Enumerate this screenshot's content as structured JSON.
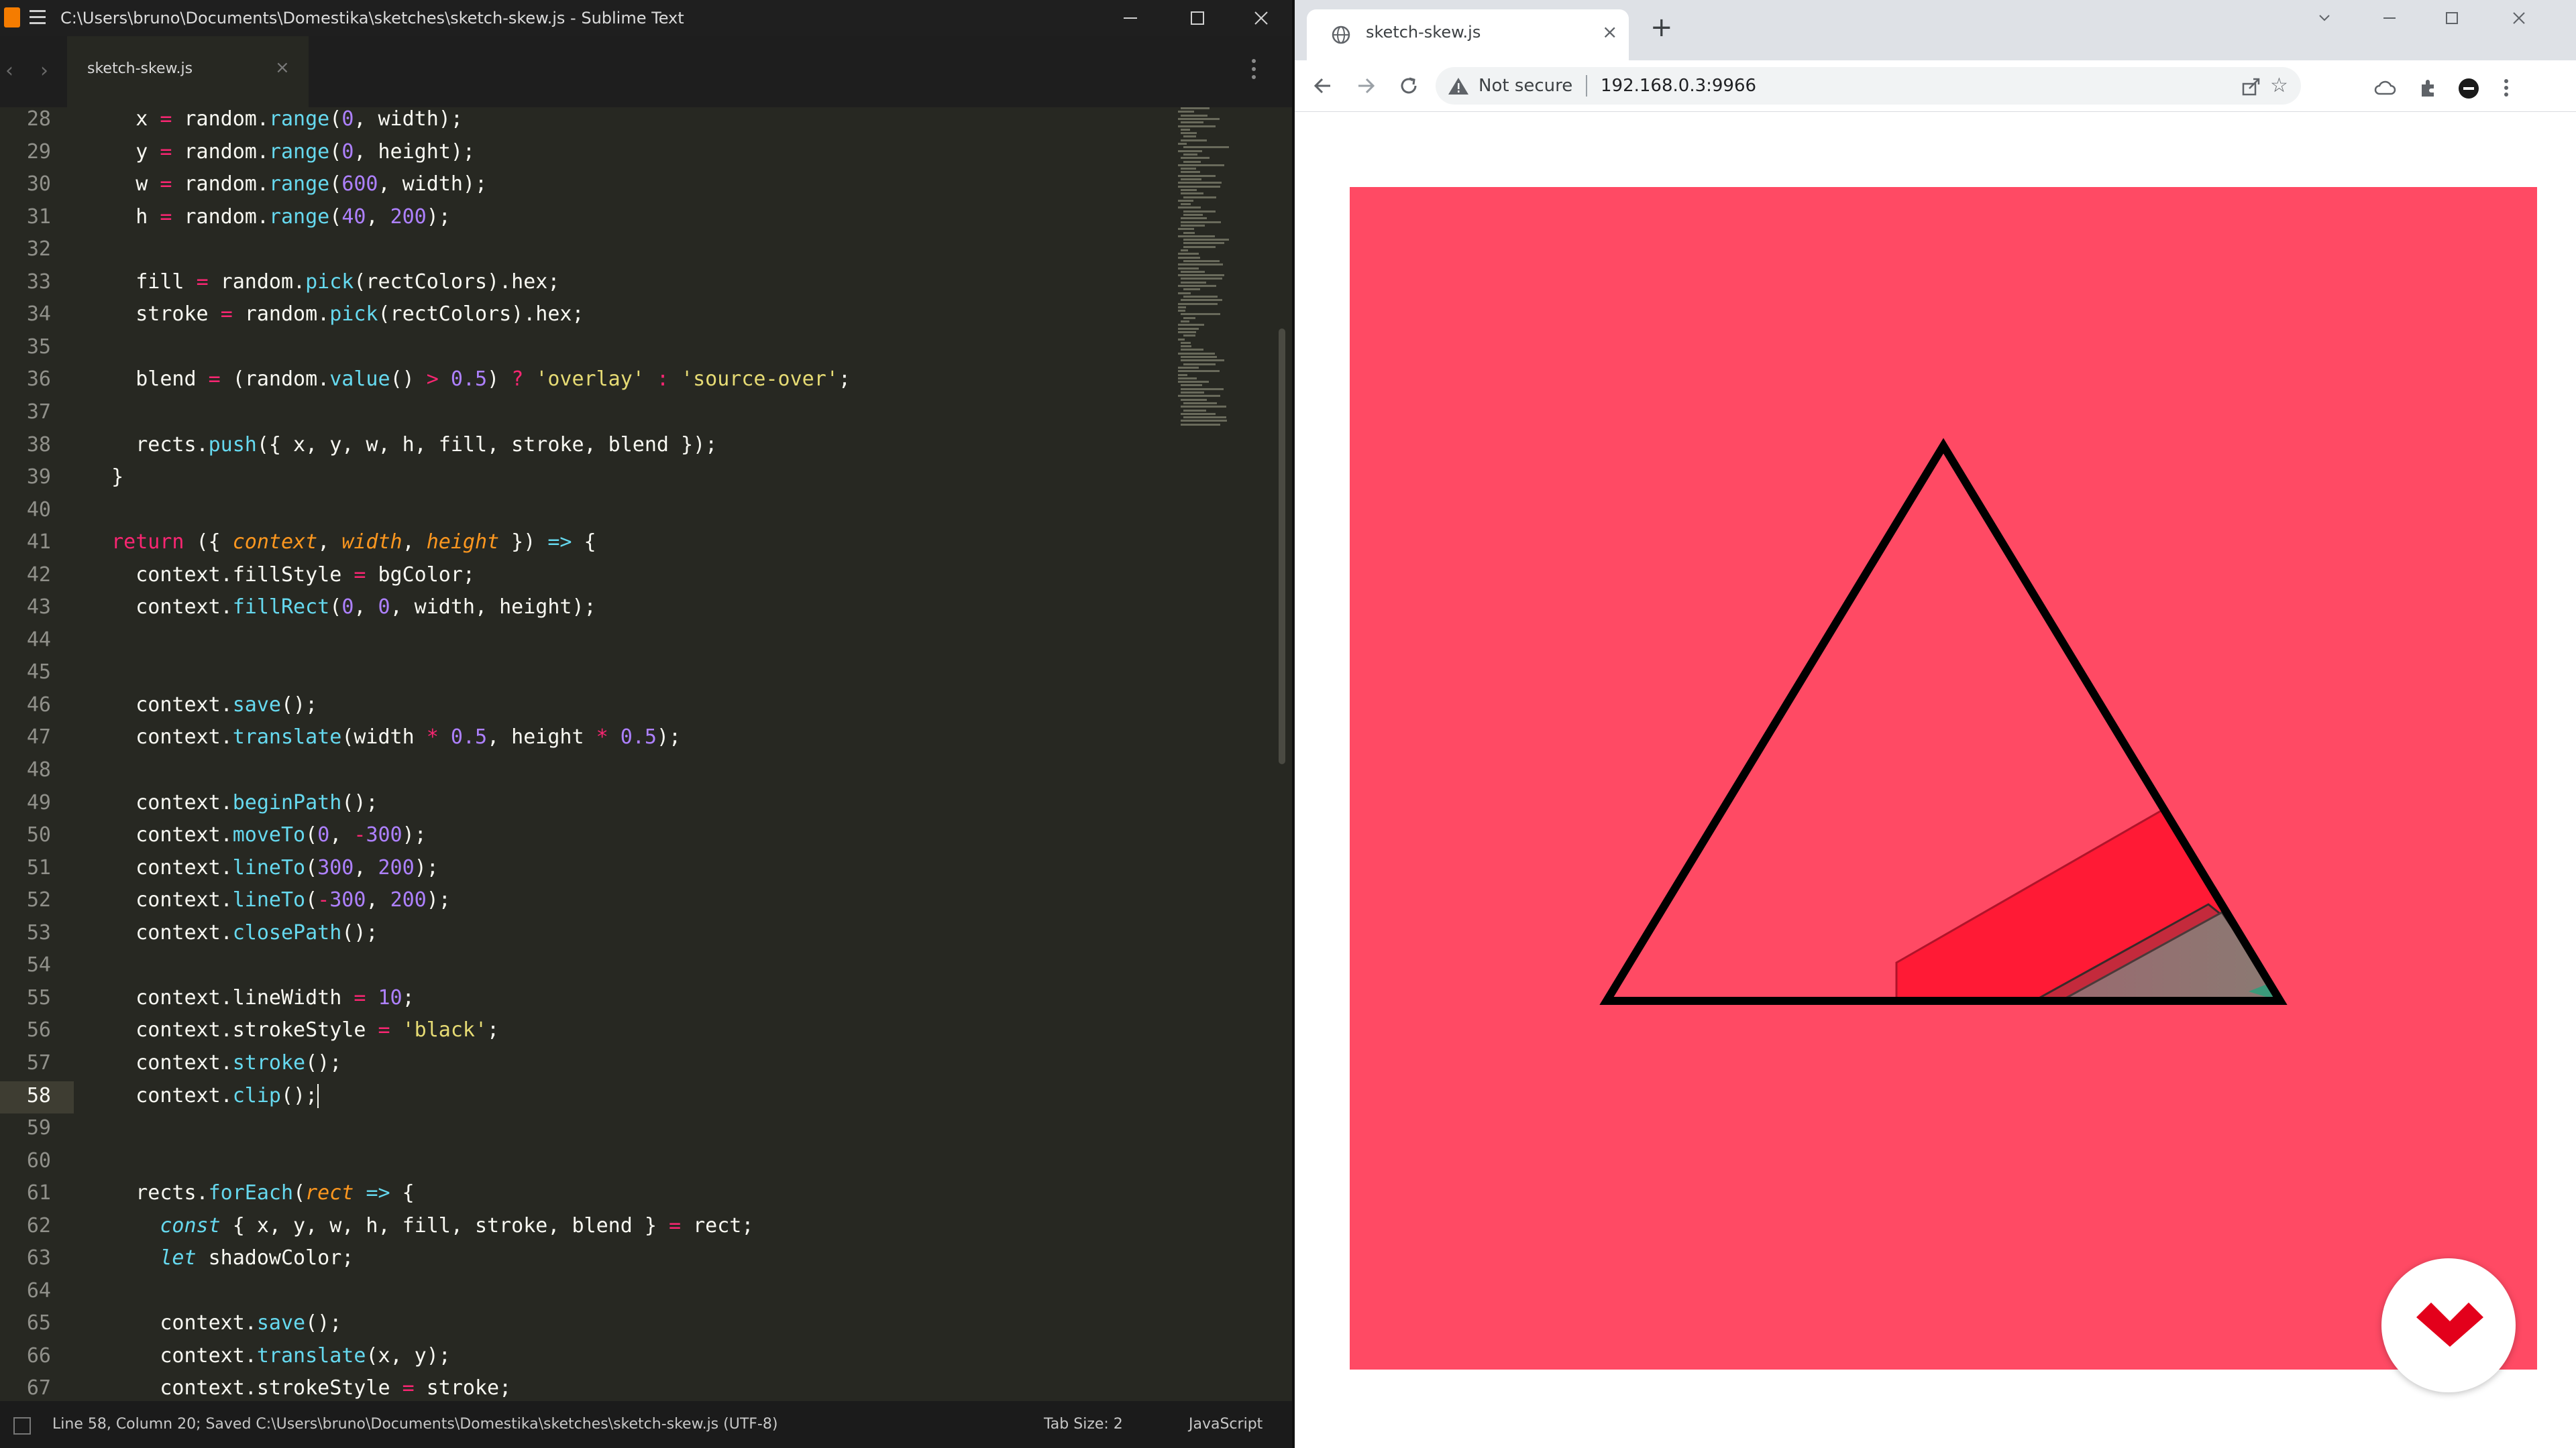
{
  "editor": {
    "window_title": "C:\\Users\\bruno\\Documents\\Domestika\\sketches\\sketch-skew.js - Sublime Text",
    "tab_label": "sketch-skew.js",
    "status": {
      "position": "Line 58, Column 20; Saved C:\\Users\\bruno\\Documents\\Domestika\\sketches\\sketch-skew.js (UTF-8)",
      "tab_size": "Tab Size: 2",
      "syntax": "JavaScript"
    },
    "current_line": 58,
    "lines": [
      {
        "n": 28,
        "html": "    x <span class=\"o\">=</span> random.<span class=\"f\">range</span>(<span class=\"n\">0</span>, width);"
      },
      {
        "n": 29,
        "html": "    y <span class=\"o\">=</span> random.<span class=\"f\">range</span>(<span class=\"n\">0</span>, height);"
      },
      {
        "n": 30,
        "html": "    w <span class=\"o\">=</span> random.<span class=\"f\">range</span>(<span class=\"n\">600</span>, width);"
      },
      {
        "n": 31,
        "html": "    h <span class=\"o\">=</span> random.<span class=\"f\">range</span>(<span class=\"n\">40</span>, <span class=\"n\">200</span>);"
      },
      {
        "n": 32,
        "html": ""
      },
      {
        "n": 33,
        "html": "    fill <span class=\"o\">=</span> random.<span class=\"f\">pick</span>(rectColors).hex;"
      },
      {
        "n": 34,
        "html": "    stroke <span class=\"o\">=</span> random.<span class=\"f\">pick</span>(rectColors).hex;"
      },
      {
        "n": 35,
        "html": ""
      },
      {
        "n": 36,
        "html": "    blend <span class=\"o\">=</span> (random.<span class=\"f\">value</span>() <span class=\"o\">&gt;</span> <span class=\"n\">0.5</span>) <span class=\"o\">?</span> <span class=\"s\">'overlay'</span> <span class=\"o\">:</span> <span class=\"s\">'source-over'</span>;"
      },
      {
        "n": 37,
        "html": ""
      },
      {
        "n": 38,
        "html": "    rects.<span class=\"f\">push</span>({ x, y, w, h, fill, stroke, blend });"
      },
      {
        "n": 39,
        "html": "  }"
      },
      {
        "n": 40,
        "html": ""
      },
      {
        "n": 41,
        "html": "  <span class=\"k\">return</span> ({ <span class=\"p\">context</span>, <span class=\"p\">width</span>, <span class=\"p\">height</span> }) <span class=\"t\">=&gt;</span> {"
      },
      {
        "n": 42,
        "html": "    context.fillStyle <span class=\"o\">=</span> bgColor;"
      },
      {
        "n": 43,
        "html": "    context.<span class=\"f\">fillRect</span>(<span class=\"n\">0</span>, <span class=\"n\">0</span>, width, height);"
      },
      {
        "n": 44,
        "html": ""
      },
      {
        "n": 45,
        "html": ""
      },
      {
        "n": 46,
        "html": "    context.<span class=\"f\">save</span>();"
      },
      {
        "n": 47,
        "html": "    context.<span class=\"f\">translate</span>(width <span class=\"o\">*</span> <span class=\"n\">0.5</span>, height <span class=\"o\">*</span> <span class=\"n\">0.5</span>);"
      },
      {
        "n": 48,
        "html": ""
      },
      {
        "n": 49,
        "html": "    context.<span class=\"f\">beginPath</span>();"
      },
      {
        "n": 50,
        "html": "    context.<span class=\"f\">moveTo</span>(<span class=\"n\">0</span>, <span class=\"o\">-</span><span class=\"n\">300</span>);"
      },
      {
        "n": 51,
        "html": "    context.<span class=\"f\">lineTo</span>(<span class=\"n\">300</span>, <span class=\"n\">200</span>);"
      },
      {
        "n": 52,
        "html": "    context.<span class=\"f\">lineTo</span>(<span class=\"o\">-</span><span class=\"n\">300</span>, <span class=\"n\">200</span>);"
      },
      {
        "n": 53,
        "html": "    context.<span class=\"f\">closePath</span>();"
      },
      {
        "n": 54,
        "html": ""
      },
      {
        "n": 55,
        "html": "    context.lineWidth <span class=\"o\">=</span> <span class=\"n\">10</span>;"
      },
      {
        "n": 56,
        "html": "    context.strokeStyle <span class=\"o\">=</span> <span class=\"s\">'black'</span>;"
      },
      {
        "n": 57,
        "html": "    context.<span class=\"f\">stroke</span>();"
      },
      {
        "n": 58,
        "html": "    context.<span class=\"f\">clip</span>();<span class=\"caret\"></span>"
      },
      {
        "n": 59,
        "html": ""
      },
      {
        "n": 60,
        "html": ""
      },
      {
        "n": 61,
        "html": "    rects.<span class=\"f\">forEach</span>(<span class=\"p\">rect</span> <span class=\"t\">=&gt;</span> {"
      },
      {
        "n": 62,
        "html": "      <span class=\"t\">const</span> { x, y, w, h, fill, stroke, blend } <span class=\"o\">=</span> rect;"
      },
      {
        "n": 63,
        "html": "      <span class=\"t\">let</span> shadowColor;"
      },
      {
        "n": 64,
        "html": ""
      },
      {
        "n": 65,
        "html": "      context.<span class=\"f\">save</span>();"
      },
      {
        "n": 66,
        "html": "      context.<span class=\"f\">translate</span>(x, y);"
      },
      {
        "n": 67,
        "html": "      context.strokeStyle <span class=\"o\">=</span> stroke;"
      }
    ]
  },
  "browser": {
    "tab_title": "sketch-skew.js",
    "security_label": "Not secure",
    "url": "192.168.0.3:9966",
    "canvas_bg": "#ff4a64",
    "colors": {
      "stroke": "#000000",
      "rect_fill": "#ff1a35",
      "rect_dark": "#c42a3c",
      "rect_gray": "#9a6a70"
    }
  }
}
